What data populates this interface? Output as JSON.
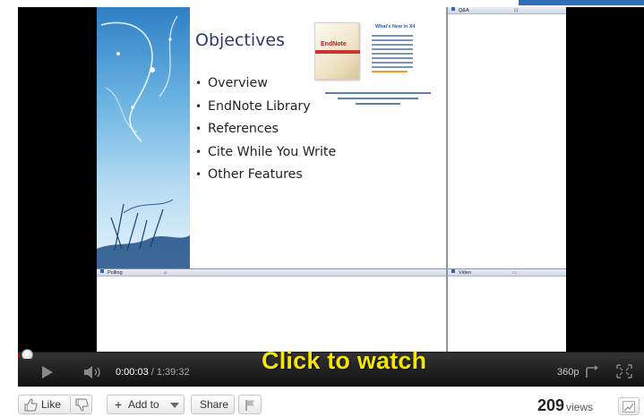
{
  "slide": {
    "title": "Objectives",
    "bullets": [
      "Overview",
      "EndNote Library",
      "References",
      "Cite While You Write",
      "Other Features"
    ],
    "promo_heading": "What's New in X4",
    "promo_brand": "EndNote"
  },
  "panels": {
    "qa_label": "Q&A",
    "polling_label": "Polling",
    "video_label": "Video"
  },
  "player": {
    "current_time": "0:00:03",
    "separator": " / ",
    "duration": "1:39:32",
    "progress_fraction": 0.0005,
    "overlay_text": "Click to watch",
    "quality": "360p",
    "overlay_color": "#f5e600"
  },
  "actions": {
    "like_label": "Like",
    "add_to_label": "Add to",
    "share_label": "Share"
  },
  "stats": {
    "views_count": "209",
    "views_label": "views"
  },
  "icons": {
    "like": "thumbs-up-icon",
    "dislike": "thumbs-down-icon",
    "flag": "flag-icon",
    "stats": "stats-icon",
    "play": "play-icon",
    "volume": "volume-icon",
    "popout": "popout-icon",
    "fullscreen": "fullscreen-icon"
  }
}
